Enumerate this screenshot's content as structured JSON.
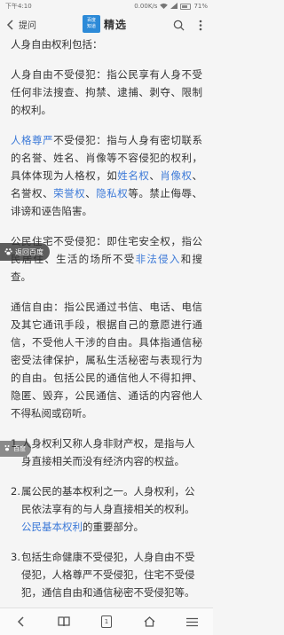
{
  "status_bar": {
    "time": "下午4:10",
    "speed": "0.00K/s",
    "battery": "71%"
  },
  "header": {
    "back_label": "提问",
    "logo_line1": "百度",
    "logo_line2": "知道",
    "logo_text": "精选"
  },
  "content": {
    "p1": "人身自由权利包括：",
    "p2": "人身自由不受侵犯：指公民享有人身不受任何非法搜查、拘禁、逮捕、剥夺、限制的权利。",
    "p3": {
      "link1": "人格尊严",
      "t1": "不受侵犯：指与人身有密切联系的名誉、姓名、肖像等不容侵犯的权利，具体体现为人格权，如",
      "link2": "姓名权",
      "t2": "、",
      "link3": "肖像权",
      "t3": "、名誉权、",
      "link4": "荣誉权",
      "t4": "、",
      "link5": "隐私权",
      "t5": "等。禁止侮辱、诽谤和诬告陷害。"
    },
    "p4": {
      "t1": "公民住宅不受侵犯：即住宅安全权，指公民居住、生活的场所不受",
      "link1": "非法侵入",
      "t2": "和搜查。"
    },
    "p5": "通信自由：指公民通过书信、电话、电信及其它通讯手段，根据自己的意愿进行通信，不受他人干涉的自由。具体指通信秘密受法律保护，属私生活秘密与表现行为的自由。包括公民的通信他人不得扣押、隐匿、毁弃，公民通信、通话的内容他人不得私阅或窃听。",
    "list": [
      {
        "num": "1.",
        "text": "人身权利又称人身非财产权，是指与人身直接相关而没有经济内容的权益。"
      },
      {
        "num": "2.",
        "text": "属公民的基本权利之一。人身权利，公民依法享有的与人身直接相关的权利。",
        "link": "公民基本权利",
        "tail": "的重要部分。"
      },
      {
        "num": "3.",
        "text": "包括生命健康不受侵犯，人身自由不受侵犯，人格尊严不受侵犯，住宅不受侵犯，通信自由和通信秘密不受侵犯等。"
      }
    ]
  },
  "float": {
    "back_label": "返回百度",
    "small_label": "百度"
  },
  "nav": {
    "page_number": "1"
  }
}
